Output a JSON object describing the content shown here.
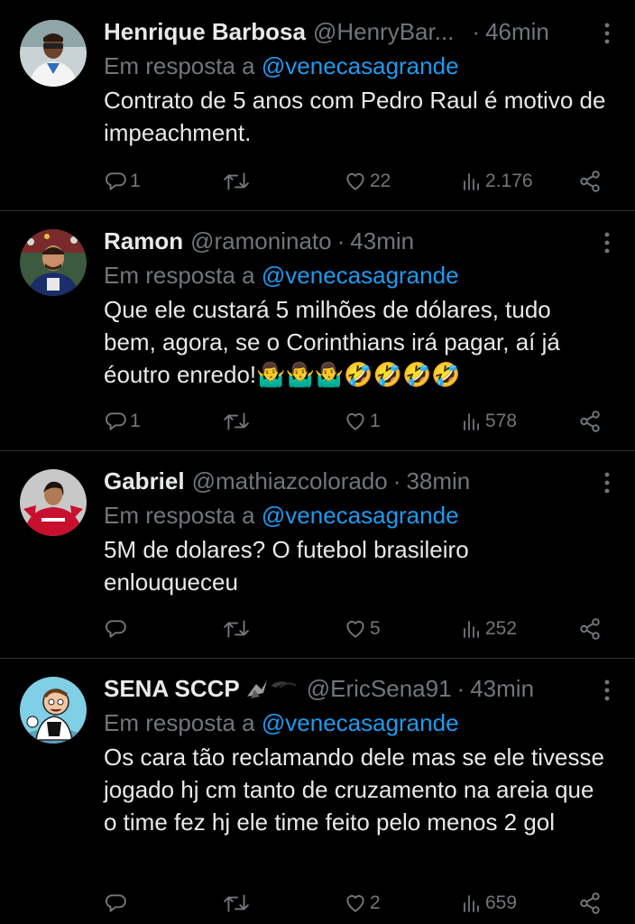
{
  "tweets": [
    {
      "name": "Henrique Barbosa",
      "handle": "@HenryBar...",
      "time": "46min",
      "reply_prefix": "Em resposta a",
      "reply_to": "@venecasagrande",
      "text": "Contrato de 5 anos com Pedro Raul é motivo de impeachment.",
      "replies": "1",
      "retweets": "",
      "likes": "22",
      "views": "2.176",
      "avatar_icon": "avatar-henrique"
    },
    {
      "name": "Ramon",
      "handle": "@ramoninato",
      "time": "43min",
      "reply_prefix": "Em resposta a",
      "reply_to": "@venecasagrande",
      "text": "Que ele custará 5 milhões de dólares, tudo bem, agora, se o Corinthians irá pagar, aí já éoutro enredo!🤷‍♂️🤷‍♂️🤷‍♂️🤣🤣🤣🤣",
      "replies": "1",
      "retweets": "",
      "likes": "1",
      "views": "578",
      "avatar_icon": "avatar-ramon"
    },
    {
      "name": "Gabriel",
      "handle": "@mathiazcolorado",
      "time": "38min",
      "reply_prefix": "Em resposta a",
      "reply_to": "@venecasagrande",
      "text": "5M de dolares? O futebol brasileiro enlouqueceu",
      "replies": "",
      "retweets": "",
      "likes": "5",
      "views": "252",
      "avatar_icon": "avatar-gabriel"
    },
    {
      "name": "SENA SCCP",
      "handle": "@EricSena91",
      "time": "43min",
      "reply_prefix": "Em resposta a",
      "reply_to": "@venecasagrande",
      "text": "Os cara tão reclamando dele mas se ele tivesse jogado hj cm tanto de cruzamento na areia que o time fez hj ele time feito pelo menos 2 gol",
      "replies": "",
      "retweets": "",
      "likes": "2",
      "views": "659",
      "avatar_icon": "avatar-sena",
      "badge_icon": "eagle-badge-icon"
    }
  ],
  "icons": {
    "reply": "reply-icon",
    "retweet": "retweet-icon",
    "like": "heart-icon",
    "views": "views-icon",
    "share": "share-icon",
    "more": "more-options-icon"
  },
  "colors": {
    "background": "#000000",
    "text": "#e7e9ea",
    "muted": "#71767b",
    "link": "#1d9bf0",
    "divider": "#2f3336"
  }
}
